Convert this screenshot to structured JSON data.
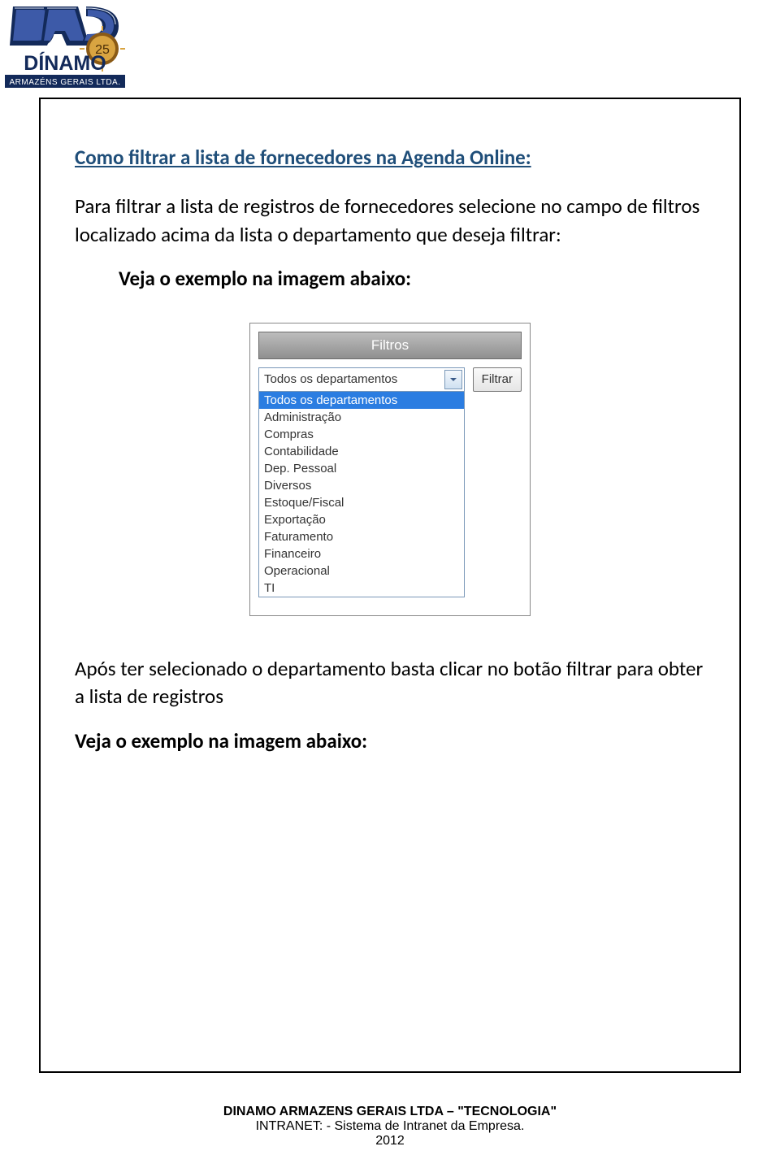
{
  "logo": {
    "top_text": "DAC",
    "brand_main": "DÍNAMO",
    "brand_sub": "ARMAZÉNS GERAIS LTDA.",
    "badge_number": "25"
  },
  "title": "Como filtrar a lista de fornecedores na Agenda Online:",
  "para1": "Para filtrar a lista de registros de fornecedores selecione no campo de filtros localizado acima da lista o departamento que deseja filtrar:",
  "veja1": "Veja o exemplo na imagem abaixo:",
  "screenshot": {
    "header": "Filtros",
    "selected": "Todos os departamentos",
    "button": "Filtrar",
    "highlighted": "Todos os departamentos",
    "options": [
      "Administração",
      "Compras",
      "Contabilidade",
      "Dep. Pessoal",
      "Diversos",
      "Estoque/Fiscal",
      "Exportação",
      "Faturamento",
      "Financeiro",
      "Operacional",
      "TI"
    ]
  },
  "para2": "Após ter selecionado o departamento basta clicar no botão filtrar para obter a lista de registros",
  "veja2": "Veja o exemplo na imagem abaixo:",
  "footer": {
    "line1": "DINAMO ARMAZENS GERAIS LTDA – \"TECNOLOGIA\"",
    "line2": "INTRANET: - Sistema de Intranet da Empresa.",
    "year": "2012"
  }
}
